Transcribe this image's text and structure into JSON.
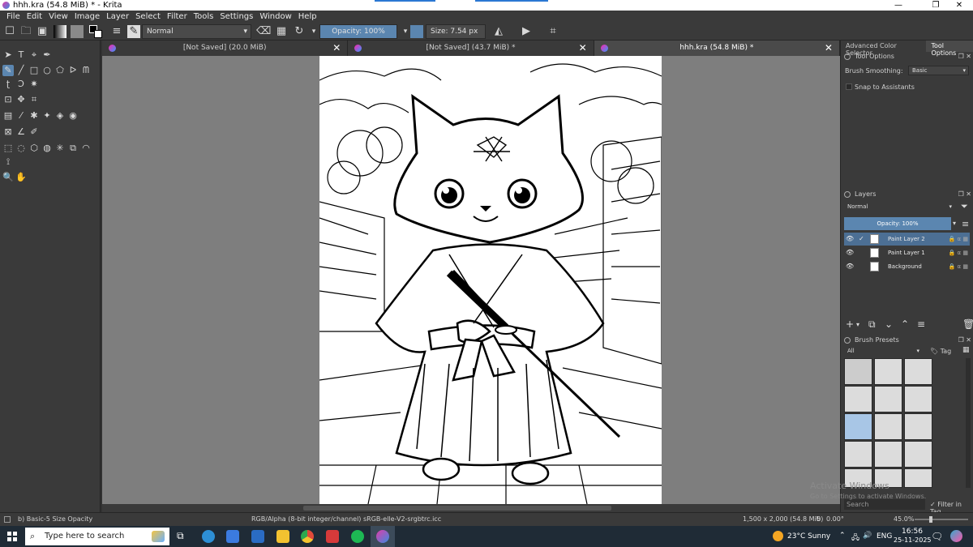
{
  "window": {
    "title": "hhh.kra (54.8 MiB) * - Krita",
    "controls": [
      "—",
      "❐",
      "✕"
    ]
  },
  "menu": [
    "File",
    "Edit",
    "View",
    "Image",
    "Layer",
    "Select",
    "Filter",
    "Tools",
    "Settings",
    "Window",
    "Help"
  ],
  "toolbar": {
    "blend_mode": "Normal",
    "opacity": "Opacity: 100%",
    "size": "Size: 7.54 px"
  },
  "tabs": [
    {
      "label": "[Not Saved]  (20.0 MiB)",
      "active": false
    },
    {
      "label": "[Not Saved]  (43.7 MiB) *",
      "active": false
    },
    {
      "label": "hhh.kra (54.8 MiB) *",
      "active": true
    }
  ],
  "right_docker": {
    "top_tabs": [
      "Advanced Color Selector",
      "Tool Options"
    ],
    "tool_options": {
      "title": "Tool Options",
      "smoothing_label": "Brush Smoothing:",
      "smoothing_value": "Basic",
      "snap_label": "Snap to Assistants"
    },
    "layers": {
      "title": "Layers",
      "blend_mode": "Normal",
      "opacity": "Opacity:  100%",
      "items": [
        {
          "name": "Paint Layer 2",
          "selected": true
        },
        {
          "name": "Paint Layer 1",
          "selected": false
        },
        {
          "name": "Background",
          "selected": false
        }
      ]
    },
    "brush_presets": {
      "title": "Brush Presets",
      "filter": "All",
      "tag": "Tag",
      "search_placeholder": "Search",
      "filter_in_tag": "Filter in Tag"
    }
  },
  "status": {
    "brush": "b) Basic-5 Size Opacity",
    "color_space": "RGB/Alpha (8-bit integer/channel)  sRGB-elle-V2-srgbtrc.icc",
    "dimensions": "1,500 x 2,000 (54.8 MiB)",
    "rotation": "0.00°",
    "zoom": "45.0%"
  },
  "watermark": {
    "line1": "Activate Windows",
    "line2": "Go to Settings to activate Windows."
  },
  "taskbar": {
    "search_placeholder": "Type here to search",
    "weather": "23°C  Sunny",
    "lang": "ENG",
    "time": "16:56",
    "date": "25-11-2025"
  },
  "colors": {
    "panel": "#3a3a3a",
    "canvas_bg": "#7e7e7e",
    "accent": "#5b86b0",
    "taskbar": "#1f2b36"
  }
}
